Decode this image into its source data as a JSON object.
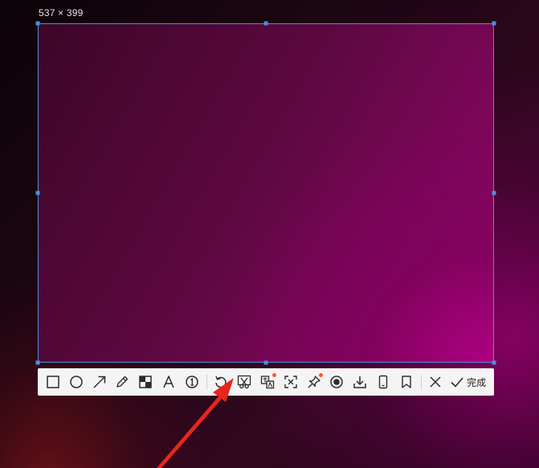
{
  "selection": {
    "dimensions": "537 × 399",
    "border_color": "#4e8fe0"
  },
  "toolbar": {
    "tools": [
      {
        "name": "rectangle",
        "icon": "rectangle-icon"
      },
      {
        "name": "ellipse",
        "icon": "ellipse-icon"
      },
      {
        "name": "arrow",
        "icon": "arrow-icon"
      },
      {
        "name": "pencil",
        "icon": "pencil-icon"
      },
      {
        "name": "mosaic",
        "icon": "mosaic-icon"
      },
      {
        "name": "text",
        "icon": "text-icon"
      },
      {
        "name": "number",
        "icon": "number-icon"
      },
      {
        "name": "undo",
        "icon": "undo-icon"
      },
      {
        "name": "cut",
        "icon": "scissors-icon"
      },
      {
        "name": "translate",
        "icon": "translate-icon",
        "badge": true
      },
      {
        "name": "ocr",
        "icon": "text-extract-icon"
      },
      {
        "name": "pin",
        "icon": "pin-icon",
        "badge": true
      },
      {
        "name": "record",
        "icon": "record-icon"
      },
      {
        "name": "download",
        "icon": "download-icon"
      },
      {
        "name": "phone",
        "icon": "phone-icon"
      },
      {
        "name": "bookmark",
        "icon": "bookmark-icon"
      },
      {
        "name": "close",
        "icon": "close-icon"
      }
    ],
    "done_label": "完成",
    "badge_color": "#ff5a2a"
  },
  "annotation": {
    "arrow_color": "#e8261d",
    "arrow_icon": "red-arrow-icon"
  }
}
